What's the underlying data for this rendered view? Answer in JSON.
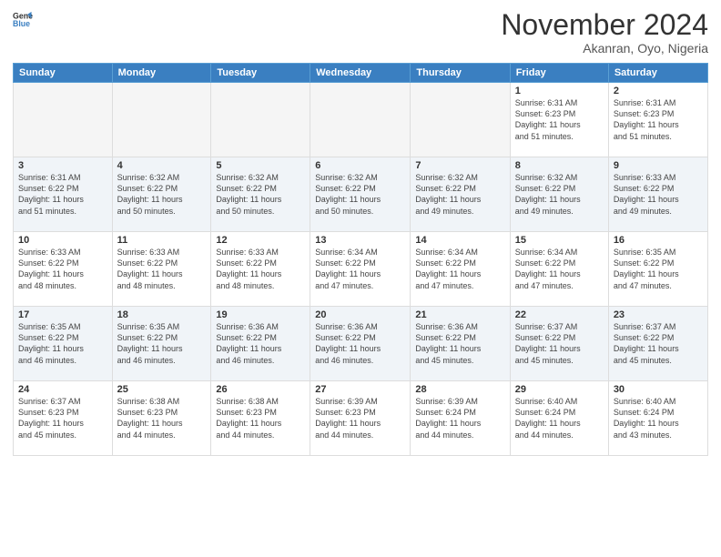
{
  "header": {
    "logo_line1": "General",
    "logo_line2": "Blue",
    "month": "November 2024",
    "location": "Akanran, Oyo, Nigeria"
  },
  "days_of_week": [
    "Sunday",
    "Monday",
    "Tuesday",
    "Wednesday",
    "Thursday",
    "Friday",
    "Saturday"
  ],
  "weeks": [
    [
      {
        "day": "",
        "info": ""
      },
      {
        "day": "",
        "info": ""
      },
      {
        "day": "",
        "info": ""
      },
      {
        "day": "",
        "info": ""
      },
      {
        "day": "",
        "info": ""
      },
      {
        "day": "1",
        "info": "Sunrise: 6:31 AM\nSunset: 6:23 PM\nDaylight: 11 hours\nand 51 minutes."
      },
      {
        "day": "2",
        "info": "Sunrise: 6:31 AM\nSunset: 6:23 PM\nDaylight: 11 hours\nand 51 minutes."
      }
    ],
    [
      {
        "day": "3",
        "info": "Sunrise: 6:31 AM\nSunset: 6:22 PM\nDaylight: 11 hours\nand 51 minutes."
      },
      {
        "day": "4",
        "info": "Sunrise: 6:32 AM\nSunset: 6:22 PM\nDaylight: 11 hours\nand 50 minutes."
      },
      {
        "day": "5",
        "info": "Sunrise: 6:32 AM\nSunset: 6:22 PM\nDaylight: 11 hours\nand 50 minutes."
      },
      {
        "day": "6",
        "info": "Sunrise: 6:32 AM\nSunset: 6:22 PM\nDaylight: 11 hours\nand 50 minutes."
      },
      {
        "day": "7",
        "info": "Sunrise: 6:32 AM\nSunset: 6:22 PM\nDaylight: 11 hours\nand 49 minutes."
      },
      {
        "day": "8",
        "info": "Sunrise: 6:32 AM\nSunset: 6:22 PM\nDaylight: 11 hours\nand 49 minutes."
      },
      {
        "day": "9",
        "info": "Sunrise: 6:33 AM\nSunset: 6:22 PM\nDaylight: 11 hours\nand 49 minutes."
      }
    ],
    [
      {
        "day": "10",
        "info": "Sunrise: 6:33 AM\nSunset: 6:22 PM\nDaylight: 11 hours\nand 48 minutes."
      },
      {
        "day": "11",
        "info": "Sunrise: 6:33 AM\nSunset: 6:22 PM\nDaylight: 11 hours\nand 48 minutes."
      },
      {
        "day": "12",
        "info": "Sunrise: 6:33 AM\nSunset: 6:22 PM\nDaylight: 11 hours\nand 48 minutes."
      },
      {
        "day": "13",
        "info": "Sunrise: 6:34 AM\nSunset: 6:22 PM\nDaylight: 11 hours\nand 47 minutes."
      },
      {
        "day": "14",
        "info": "Sunrise: 6:34 AM\nSunset: 6:22 PM\nDaylight: 11 hours\nand 47 minutes."
      },
      {
        "day": "15",
        "info": "Sunrise: 6:34 AM\nSunset: 6:22 PM\nDaylight: 11 hours\nand 47 minutes."
      },
      {
        "day": "16",
        "info": "Sunrise: 6:35 AM\nSunset: 6:22 PM\nDaylight: 11 hours\nand 47 minutes."
      }
    ],
    [
      {
        "day": "17",
        "info": "Sunrise: 6:35 AM\nSunset: 6:22 PM\nDaylight: 11 hours\nand 46 minutes."
      },
      {
        "day": "18",
        "info": "Sunrise: 6:35 AM\nSunset: 6:22 PM\nDaylight: 11 hours\nand 46 minutes."
      },
      {
        "day": "19",
        "info": "Sunrise: 6:36 AM\nSunset: 6:22 PM\nDaylight: 11 hours\nand 46 minutes."
      },
      {
        "day": "20",
        "info": "Sunrise: 6:36 AM\nSunset: 6:22 PM\nDaylight: 11 hours\nand 46 minutes."
      },
      {
        "day": "21",
        "info": "Sunrise: 6:36 AM\nSunset: 6:22 PM\nDaylight: 11 hours\nand 45 minutes."
      },
      {
        "day": "22",
        "info": "Sunrise: 6:37 AM\nSunset: 6:22 PM\nDaylight: 11 hours\nand 45 minutes."
      },
      {
        "day": "23",
        "info": "Sunrise: 6:37 AM\nSunset: 6:22 PM\nDaylight: 11 hours\nand 45 minutes."
      }
    ],
    [
      {
        "day": "24",
        "info": "Sunrise: 6:37 AM\nSunset: 6:23 PM\nDaylight: 11 hours\nand 45 minutes."
      },
      {
        "day": "25",
        "info": "Sunrise: 6:38 AM\nSunset: 6:23 PM\nDaylight: 11 hours\nand 44 minutes."
      },
      {
        "day": "26",
        "info": "Sunrise: 6:38 AM\nSunset: 6:23 PM\nDaylight: 11 hours\nand 44 minutes."
      },
      {
        "day": "27",
        "info": "Sunrise: 6:39 AM\nSunset: 6:23 PM\nDaylight: 11 hours\nand 44 minutes."
      },
      {
        "day": "28",
        "info": "Sunrise: 6:39 AM\nSunset: 6:24 PM\nDaylight: 11 hours\nand 44 minutes."
      },
      {
        "day": "29",
        "info": "Sunrise: 6:40 AM\nSunset: 6:24 PM\nDaylight: 11 hours\nand 44 minutes."
      },
      {
        "day": "30",
        "info": "Sunrise: 6:40 AM\nSunset: 6:24 PM\nDaylight: 11 hours\nand 43 minutes."
      }
    ]
  ]
}
